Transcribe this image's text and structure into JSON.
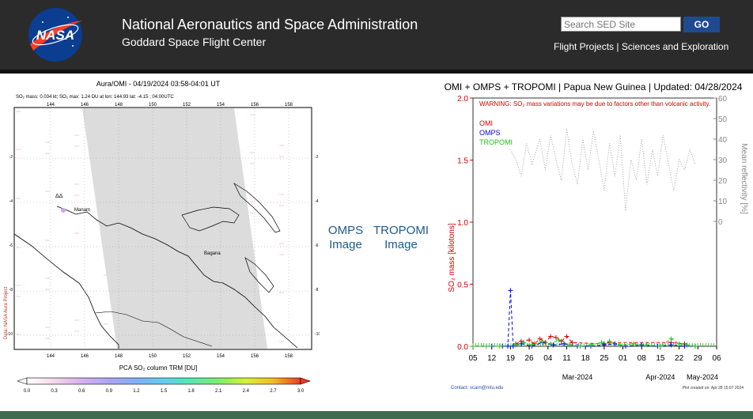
{
  "header": {
    "agency": "National Aeronautics and Space Administration",
    "center": "Goddard Space Flight Center",
    "logo_text": "NASA",
    "search_placeholder": "Search SED Site",
    "go_label": "GO",
    "links": [
      {
        "label": "Flight Projects"
      },
      {
        "label": "Sciences and Exploration"
      }
    ],
    "link_separator": "|"
  },
  "map": {
    "title": "Aura/OMI - 04/19/2024 03:58-04:01 UT",
    "subtitle": "SO₂ mass: 0.034 kt; SO₂ max: 1.24 DU at lon: 144.93 lat: -4.15 ; 04:00UTC",
    "lon_ticks": [
      "144",
      "146",
      "148",
      "150",
      "152",
      "154",
      "156",
      "158"
    ],
    "lat_ticks": [
      "-2",
      "-4",
      "-6",
      "-8",
      "-10"
    ],
    "place_labels": [
      "Manam",
      "Bagana"
    ],
    "side_label": "Data: NASA Aura Project",
    "colorbar_title": "PCA SO₂ column TRM [DU]",
    "colorbar_ticks": [
      "0.0",
      "0.3",
      "0.6",
      "0.9",
      "1.2",
      "1.5",
      "1.8",
      "2.1",
      "2.4",
      "2.7",
      "3.0"
    ],
    "colorbar_colors": [
      "#ffffff",
      "#f6d6ea",
      "#d8b0f0",
      "#a9a6f5",
      "#7fb0f8",
      "#5fd0f0",
      "#55e8b0",
      "#7af06a",
      "#d8f03a",
      "#f8b82a",
      "#ee3a20"
    ]
  },
  "captions": {
    "omps": [
      "OMPS",
      "Image"
    ],
    "tropomi": [
      "TROPOMI",
      "Image"
    ]
  },
  "chart_data": {
    "type": "line",
    "title": "OMI + OMPS + TROPOMI | Papua New Guinea | Updated: 04/28/2024",
    "warning": "WARNING: SO₂ mass variations may be due to factors other than volcanic activity.",
    "ylabel": "SO₂ mass [kilotons]",
    "ylabel_right": "Mean reflectivity [%]",
    "ylim": [
      0,
      2.0
    ],
    "yticks": [
      "0.0",
      "0.5",
      "1.0",
      "1.5",
      "2.0"
    ],
    "y2lim": [
      0,
      60
    ],
    "y2ticks": [
      "0",
      "10",
      "20",
      "30",
      "40",
      "50",
      "60"
    ],
    "xlim": [
      "2024-02-05",
      "2024-05-06"
    ],
    "xticks": [
      "05",
      "12",
      "19",
      "26",
      "04",
      "11",
      "18",
      "25",
      "01",
      "08",
      "15",
      "22",
      "29",
      "06"
    ],
    "month_labels": [
      "Mar-2024",
      "Apr-2024",
      "May-2024"
    ],
    "grid": false,
    "legend_position": "top-left",
    "series": [
      {
        "name": "OMI",
        "color": "#e00000",
        "values_note": "",
        "points": [
          [
            "2024-02-21",
            0.02
          ],
          [
            "2024-02-23",
            0.04
          ],
          [
            "2024-02-26",
            0.05
          ],
          [
            "2024-02-28",
            0.02
          ],
          [
            "2024-03-01",
            0.06
          ],
          [
            "2024-03-03",
            0.03
          ],
          [
            "2024-03-05",
            0.08
          ],
          [
            "2024-03-07",
            0.07
          ],
          [
            "2024-03-09",
            0.04
          ],
          [
            "2024-03-11",
            0.08
          ],
          [
            "2024-03-13",
            0.03
          ],
          [
            "2024-03-25",
            0.02
          ],
          [
            "2024-03-27",
            0.03
          ],
          [
            "2024-04-19",
            0.03
          ],
          [
            "2024-04-24",
            0.02
          ]
        ]
      },
      {
        "name": "OMPS",
        "color": "#0000e0",
        "points": [
          [
            "2024-02-05",
            0.0
          ],
          [
            "2024-02-12",
            0.0
          ],
          [
            "2024-02-16",
            0.0
          ],
          [
            "2024-02-18",
            0.0
          ],
          [
            "2024-02-19",
            0.45
          ],
          [
            "2024-02-20",
            0.0
          ],
          [
            "2024-02-23",
            0.02
          ],
          [
            "2024-02-27",
            0.0
          ],
          [
            "2024-03-02",
            0.03
          ],
          [
            "2024-03-06",
            0.01
          ],
          [
            "2024-03-10",
            0.02
          ],
          [
            "2024-03-15",
            0.0
          ],
          [
            "2024-03-20",
            0.0
          ],
          [
            "2024-03-25",
            0.01
          ],
          [
            "2024-03-29",
            0.02
          ],
          [
            "2024-04-02",
            0.0
          ],
          [
            "2024-04-08",
            0.01
          ],
          [
            "2024-04-14",
            0.0
          ],
          [
            "2024-04-19",
            0.01
          ],
          [
            "2024-04-24",
            0.0
          ],
          [
            "2024-04-28",
            0.0
          ]
        ]
      },
      {
        "name": "TROPOMI",
        "color": "#20c020",
        "points": [
          [
            "2024-02-05",
            0.0
          ],
          [
            "2024-02-10",
            0.0
          ],
          [
            "2024-02-15",
            0.0
          ],
          [
            "2024-02-21",
            0.01
          ],
          [
            "2024-02-24",
            0.03
          ],
          [
            "2024-02-27",
            0.01
          ],
          [
            "2024-03-02",
            0.04
          ],
          [
            "2024-03-05",
            0.02
          ],
          [
            "2024-03-08",
            0.05
          ],
          [
            "2024-03-12",
            0.01
          ],
          [
            "2024-03-16",
            0.0
          ],
          [
            "2024-03-20",
            0.01
          ],
          [
            "2024-03-24",
            0.03
          ],
          [
            "2024-03-27",
            0.04
          ],
          [
            "2024-03-31",
            0.01
          ],
          [
            "2024-04-05",
            0.02
          ],
          [
            "2024-04-10",
            0.01
          ],
          [
            "2024-04-15",
            0.0
          ],
          [
            "2024-04-19",
            0.06
          ],
          [
            "2024-04-22",
            0.02
          ],
          [
            "2024-04-25",
            0.01
          ],
          [
            "2024-04-28",
            0.0
          ]
        ]
      },
      {
        "name": "Mean reflectivity",
        "axis": "right",
        "color": "#999999",
        "points": [
          [
            "2024-02-19",
            35
          ],
          [
            "2024-02-21",
            30
          ],
          [
            "2024-02-23",
            22
          ],
          [
            "2024-02-25",
            38
          ],
          [
            "2024-02-27",
            28
          ],
          [
            "2024-03-01",
            40
          ],
          [
            "2024-03-03",
            25
          ],
          [
            "2024-03-05",
            42
          ],
          [
            "2024-03-07",
            30
          ],
          [
            "2024-03-09",
            20
          ],
          [
            "2024-03-11",
            45
          ],
          [
            "2024-03-13",
            28
          ],
          [
            "2024-03-15",
            18
          ],
          [
            "2024-03-17",
            40
          ],
          [
            "2024-03-19",
            25
          ],
          [
            "2024-03-21",
            44
          ],
          [
            "2024-03-23",
            30
          ],
          [
            "2024-03-25",
            15
          ],
          [
            "2024-03-27",
            38
          ],
          [
            "2024-03-29",
            22
          ],
          [
            "2024-03-31",
            42
          ],
          [
            "2024-04-02",
            5
          ],
          [
            "2024-04-04",
            30
          ],
          [
            "2024-04-06",
            20
          ],
          [
            "2024-04-08",
            40
          ],
          [
            "2024-04-10",
            18
          ],
          [
            "2024-04-12",
            35
          ],
          [
            "2024-04-14",
            22
          ],
          [
            "2024-04-16",
            42
          ],
          [
            "2024-04-18",
            28
          ],
          [
            "2024-04-20",
            15
          ],
          [
            "2024-04-22",
            30
          ],
          [
            "2024-04-24",
            25
          ],
          [
            "2024-04-26",
            35
          ],
          [
            "2024-04-28",
            28
          ]
        ]
      }
    ],
    "footer_left": "Contact: scarn@mtu.edu",
    "footer_right": "Plot created on: Apr 28 15:07 2024"
  }
}
